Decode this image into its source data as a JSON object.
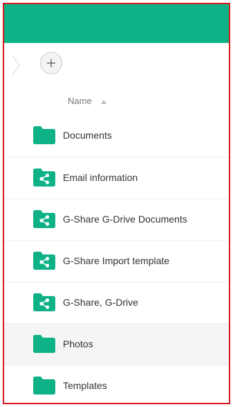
{
  "theme": {
    "header_color": "#0fb286",
    "folder_color": "#0fb286",
    "highlight_row": "#f5f5f5",
    "border_color": "#d71920"
  },
  "breadcrumb": {
    "add_button_icon": "plus-icon",
    "separator_icon": "chevron-right-icon"
  },
  "columns": {
    "name_label": "Name",
    "sort_icon": "sort-ascending-icon"
  },
  "files": [
    {
      "name": "Documents",
      "type": "folder",
      "icon": "folder-icon"
    },
    {
      "name": "Email information",
      "type": "shared-folder",
      "icon": "shared-folder-icon"
    },
    {
      "name": "G-Share G-Drive Documents",
      "type": "shared-folder",
      "icon": "shared-folder-icon"
    },
    {
      "name": "G-Share Import template",
      "type": "shared-folder",
      "icon": "shared-folder-icon"
    },
    {
      "name": "G-Share, G-Drive",
      "type": "shared-folder",
      "icon": "shared-folder-icon"
    },
    {
      "name": "Photos",
      "type": "folder",
      "icon": "folder-icon",
      "highlighted": true
    },
    {
      "name": "Templates",
      "type": "folder",
      "icon": "folder-icon"
    }
  ]
}
